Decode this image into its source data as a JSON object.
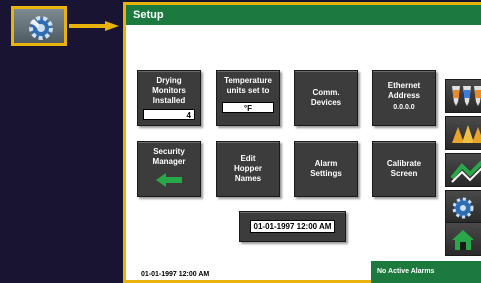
{
  "window": {
    "title": "Setup"
  },
  "tiles": {
    "drying_monitors": {
      "label": [
        "Drying",
        "Monitors",
        "Installed"
      ],
      "value": "4"
    },
    "temperature_units": {
      "label": [
        "Temperature",
        "units set to"
      ],
      "value": "°F"
    },
    "comm_devices": {
      "label": [
        "Comm.",
        "Devices"
      ]
    },
    "ethernet_address": {
      "label": [
        "Ethernet",
        "Address"
      ],
      "value": "0.0.0.0"
    },
    "security_manager": {
      "label": [
        "Security",
        "Manager"
      ]
    },
    "edit_hopper_names": {
      "label": [
        "Edit",
        "Hopper",
        "Names"
      ]
    },
    "alarm_settings": {
      "label": [
        "Alarm",
        "Settings"
      ]
    },
    "calibrate_screen": {
      "label": [
        "Calibrate",
        "Screen"
      ]
    }
  },
  "datetime_button": {
    "value": "01-01-1997 12:00 AM"
  },
  "footer": {
    "datetime": "01-01-1997 12:00 AM",
    "alarm_status": "No Active Alarms"
  },
  "nav": [
    "hoppers-icon",
    "dryers-icon",
    "trend-icon",
    "settings-icon",
    "home-icon"
  ],
  "colors": {
    "title_bar": "#1d7a3e",
    "accent": "#e8b30d",
    "tile": "#3c3c3c"
  }
}
